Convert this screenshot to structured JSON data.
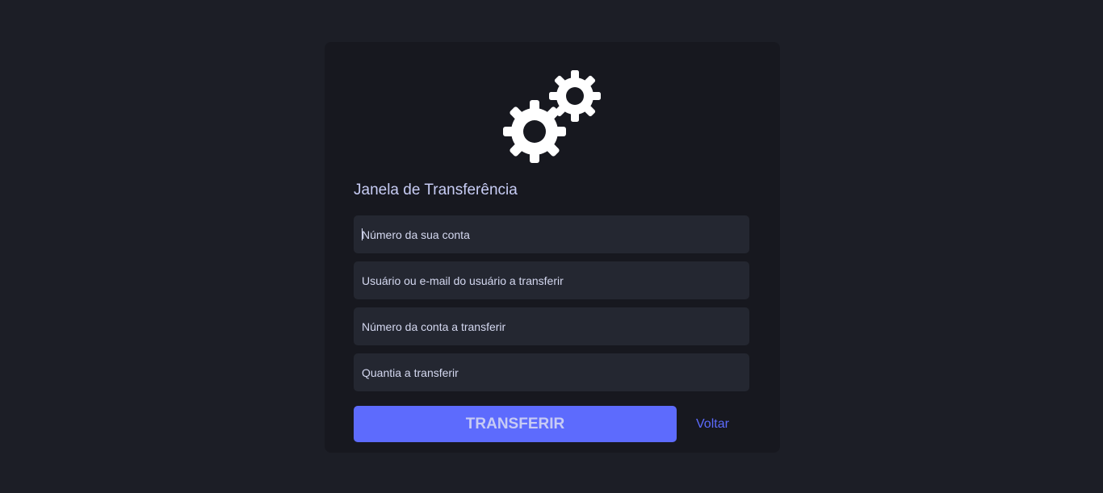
{
  "card": {
    "logo_icon": "gears-icon",
    "title": "Janela de Transferência"
  },
  "form": {
    "fields": [
      {
        "name": "account-number",
        "placeholder": "Número da sua conta",
        "value": ""
      },
      {
        "name": "recipient-user",
        "placeholder": "Usuário ou e-mail do usuário a transferir",
        "value": ""
      },
      {
        "name": "recipient-account",
        "placeholder": "Número da conta a transferir",
        "value": ""
      },
      {
        "name": "amount",
        "placeholder": "Quantia a transferir",
        "value": ""
      }
    ],
    "submit_label": "TRANSFERIR",
    "back_label": "Voltar"
  },
  "colors": {
    "background": "#1c1e26",
    "card": "#17181f",
    "input": "#242731",
    "accent": "#5d6bfd",
    "title": "#c8cdf5"
  }
}
